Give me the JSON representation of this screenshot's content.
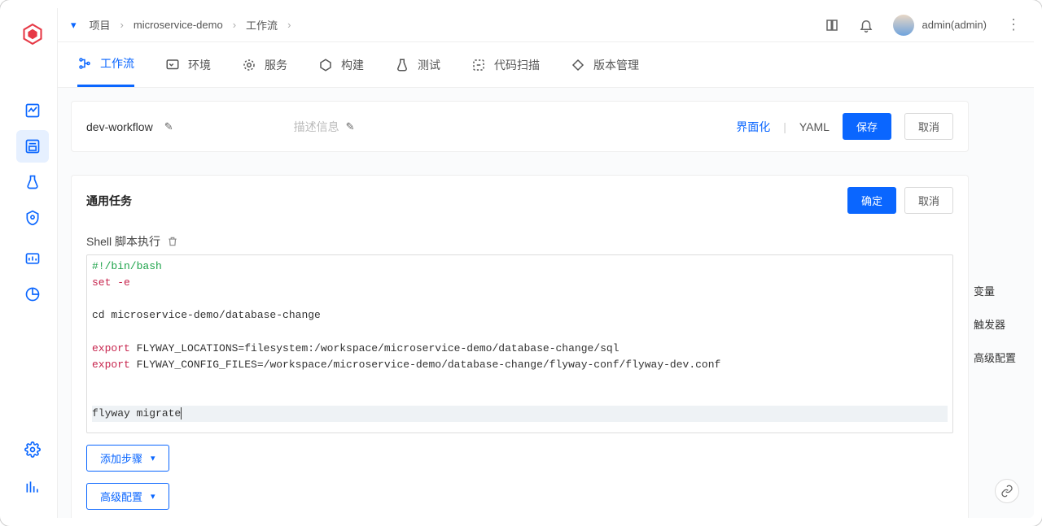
{
  "breadcrumb": {
    "project_label": "项目",
    "project_name": "microservice-demo",
    "workflow_label": "工作流"
  },
  "user": {
    "display": "admin(admin)"
  },
  "tabs": {
    "workflow": "工作流",
    "env": "环境",
    "service": "服务",
    "build": "构建",
    "test": "测试",
    "codescan": "代码扫描",
    "version": "版本管理"
  },
  "wf": {
    "name": "dev-workflow",
    "desc_placeholder": "描述信息",
    "mode_ui": "界面化",
    "mode_yaml": "YAML",
    "save": "保存",
    "cancel": "取消"
  },
  "task": {
    "title": "通用任务",
    "confirm": "确定",
    "cancel": "取消",
    "shell_label": "Shell 脚本执行",
    "add_step": "添加步骤",
    "adv_cfg": "高级配置"
  },
  "code": {
    "l1_shebang": "#!/bin/bash",
    "l2_set": "set",
    "l2_flag": " -e",
    "l4": "cd microservice-demo/database-change",
    "l6_kw": "export",
    "l6_rest": " FLYWAY_LOCATIONS=filesystem:/workspace/microservice-demo/database-change/sql",
    "l7_kw": "export",
    "l7_rest": " FLYWAY_CONFIG_FILES=/workspace/microservice-demo/database-change/flyway-conf/flyway-dev.conf",
    "l10": "flyway migrate"
  },
  "anchors": {
    "vars": "变量",
    "triggers": "触发器",
    "adv": "高级配置"
  }
}
